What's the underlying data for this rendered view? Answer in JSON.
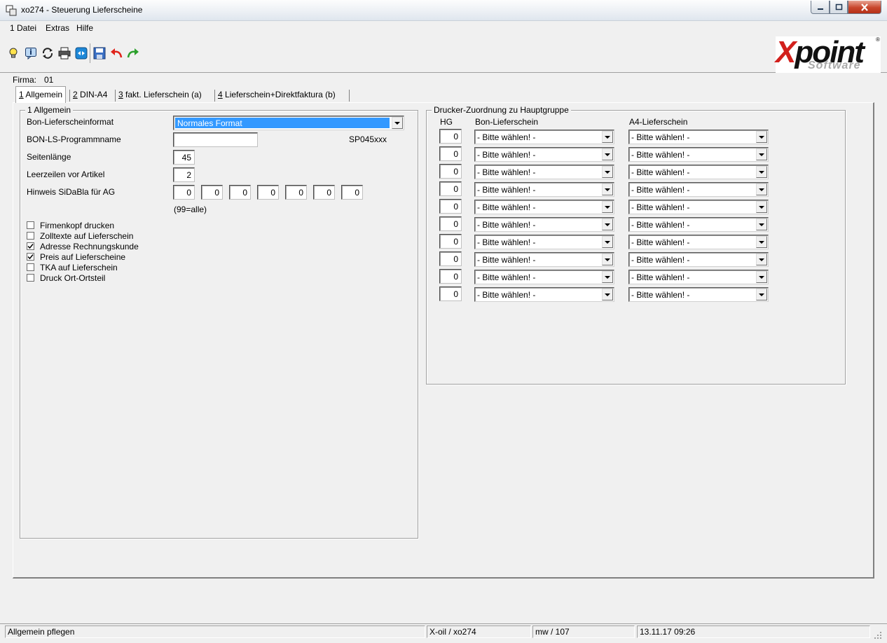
{
  "window": {
    "title": "xo274 - Steuerung Lieferscheine"
  },
  "menu": {
    "items": [
      "1 Datei",
      "Extras",
      "Hilfe"
    ]
  },
  "logo": {
    "brand_first": "X",
    "brand_rest": "point",
    "sub": "Software",
    "reg": "®"
  },
  "firma": {
    "label": "Firma:",
    "value": "01"
  },
  "tabs": [
    {
      "num": "1",
      "rest": " Allgemein"
    },
    {
      "num": "2",
      "rest": " DIN-A4"
    },
    {
      "num": "3",
      "rest": " fakt. Lieferschein (a)"
    },
    {
      "num": "4",
      "rest": " Lieferschein+Direktfaktura (b)"
    }
  ],
  "allgemein": {
    "group_title": "1 Allgemein",
    "bon_format_label": "Bon-Lieferscheinformat",
    "bon_format_value": "Normales Format",
    "programm_label": "BON-LS-Programmname",
    "programm_value": "",
    "programm_hint": "SP045xxx",
    "seitenlaenge_label": "Seitenlänge",
    "seitenlaenge_value": "45",
    "leerzeilen_label": "Leerzeilen vor Artikel",
    "leerzeilen_value": "2",
    "hinweis_label": "Hinweis SiDaBla für AG",
    "hinweis_values": [
      "0",
      "0",
      "0",
      "0",
      "0",
      "0",
      "0"
    ],
    "hinweis_hint": "(99=alle)",
    "checkboxes": [
      {
        "label": "Firmenkopf drucken",
        "checked": false
      },
      {
        "label": "Zolltexte auf Lieferschein",
        "checked": false
      },
      {
        "label": "Adresse Rechnungskunde",
        "checked": true
      },
      {
        "label": "Preis auf Lieferscheine",
        "checked": true
      },
      {
        "label": "TKA auf Lieferschein",
        "checked": false
      },
      {
        "label": "Druck Ort-Ortsteil",
        "checked": false
      }
    ]
  },
  "drucker": {
    "group_title": "Drucker-Zuordnung zu Hauptgruppe",
    "headers": {
      "hg": "HG",
      "bon": "Bon-Lieferschein",
      "a4": "A4-Lieferschein"
    },
    "rows": [
      {
        "hg": "0",
        "bon": "- Bitte wählen! -",
        "a4": "- Bitte wählen! -"
      },
      {
        "hg": "0",
        "bon": "- Bitte wählen! -",
        "a4": "- Bitte wählen! -"
      },
      {
        "hg": "0",
        "bon": "- Bitte wählen! -",
        "a4": "- Bitte wählen! -"
      },
      {
        "hg": "0",
        "bon": "- Bitte wählen! -",
        "a4": "- Bitte wählen! -"
      },
      {
        "hg": "0",
        "bon": "- Bitte wählen! -",
        "a4": "- Bitte wählen! -"
      },
      {
        "hg": "0",
        "bon": "- Bitte wählen! -",
        "a4": "- Bitte wählen! -"
      },
      {
        "hg": "0",
        "bon": "- Bitte wählen! -",
        "a4": "- Bitte wählen! -"
      },
      {
        "hg": "0",
        "bon": "- Bitte wählen! -",
        "a4": "- Bitte wählen! -"
      },
      {
        "hg": "0",
        "bon": "- Bitte wählen! -",
        "a4": "- Bitte wählen! -"
      },
      {
        "hg": "0",
        "bon": "- Bitte wählen! -",
        "a4": "- Bitte wählen! -"
      }
    ]
  },
  "status": {
    "message": "Allgemein pflegen",
    "system": "X-oil / xo274",
    "user": "mw / 107",
    "datetime": "13.11.17 09:26"
  },
  "colors": {
    "selection": "#3399ff",
    "logo_red": "#d2201c",
    "close_button": "#c8462c",
    "undo_red": "#e0241b",
    "redo_green": "#2ca02c"
  }
}
